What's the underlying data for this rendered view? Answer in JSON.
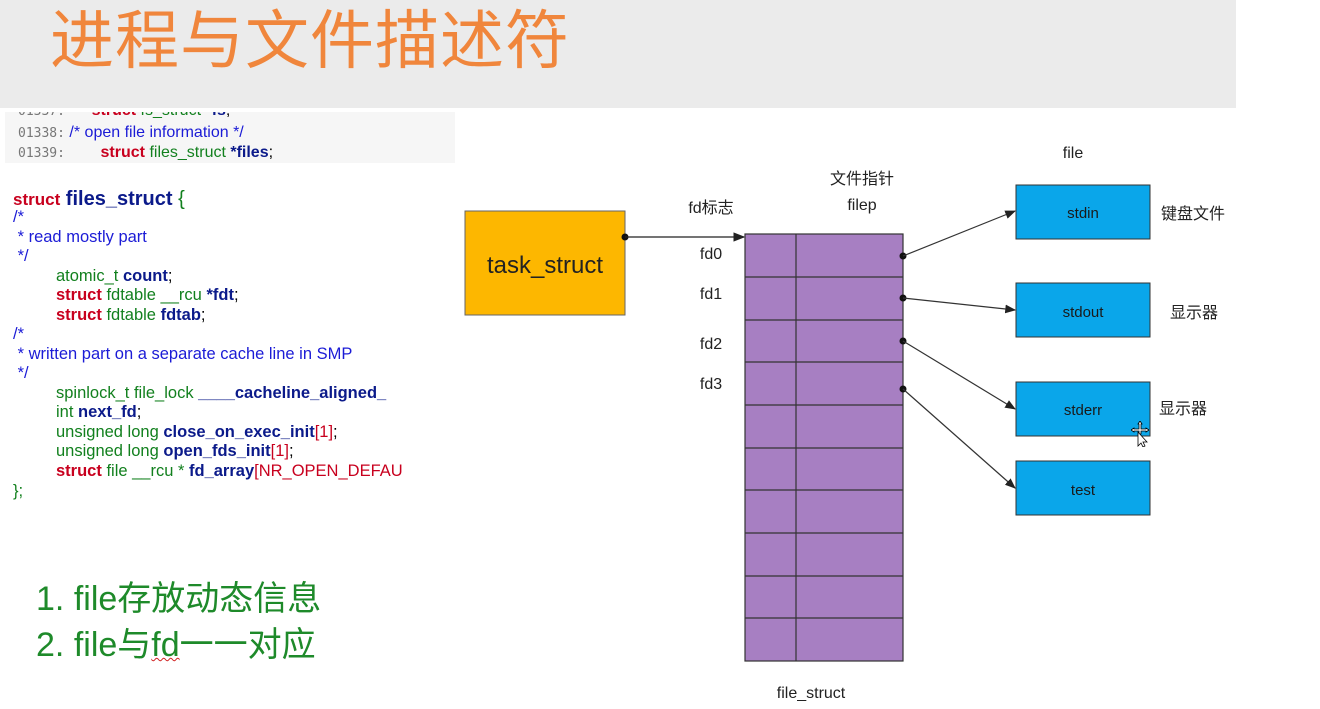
{
  "title": "进程与文件描述符",
  "code_top": [
    {
      "ln": "01338:",
      "text": "/* open file information */"
    },
    {
      "ln": "01339:",
      "kw": "struct",
      "type": "files_struct",
      "ptr": "*files",
      "end": ";"
    }
  ],
  "code": {
    "l1_kw": "struct",
    "l1_id": "files_struct",
    "l1_brace": "{",
    "c1": "/*",
    "c2": " * read mostly part",
    "c3": " */",
    "f1_type": "atomic_t",
    "f1_name": "count",
    "f1_end": ";",
    "f2_kw": "struct",
    "f2_type": "fdtable",
    "f2_rcu": "__rcu",
    "f2_name": "*fdt",
    "f2_end": ";",
    "f3_kw": "struct",
    "f3_type": "fdtable",
    "f3_name": "fdtab",
    "f3_end": ";",
    "c4": "/*",
    "c5": " * written part on a separate cache line in SMP",
    "c6": " */",
    "f4_type": "spinlock_t file_lock",
    "f4_name": "____cacheline_aligned_",
    "f5_type": "int",
    "f5_name": "next_fd",
    "f5_end": ";",
    "f6_type": "unsigned long",
    "f6_name": "close_on_exec_init",
    "f6_idx": "[1]",
    "f6_end": ";",
    "f7_type": "unsigned long",
    "f7_name": "open_fds_init",
    "f7_idx": "[1]",
    "f7_end": ";",
    "f8_kw": "struct",
    "f8_type": "file",
    "f8_rcu": "__rcu *",
    "f8_name": "fd_array",
    "f8_idx": "[NR_OPEN_DEFAU",
    "close": "};"
  },
  "bullets": [
    {
      "num": "1.",
      "text": "file存放动态信息"
    },
    {
      "num": "2.",
      "pre": "file与",
      "fd": "fd",
      "post": "一一对应"
    }
  ],
  "diagram": {
    "task_label": "task_struct",
    "fd_header": "fd标志",
    "filep_header_cn": "文件指针",
    "filep_header": "filep",
    "fd_labels": [
      "fd0",
      "fd1",
      "fd2",
      "fd3"
    ],
    "file_header": "file",
    "files": [
      {
        "label": "stdin",
        "desc": "键盘文件"
      },
      {
        "label": "stdout",
        "desc": "显示器"
      },
      {
        "label": "stderr",
        "desc": "显示器"
      },
      {
        "label": "test",
        "desc": ""
      }
    ],
    "table_label": "file_struct",
    "colors": {
      "task_fill": "#fdb700",
      "table_fill": "#a77fc2",
      "file_fill": "#0aa6ea",
      "line": "#333333"
    }
  }
}
